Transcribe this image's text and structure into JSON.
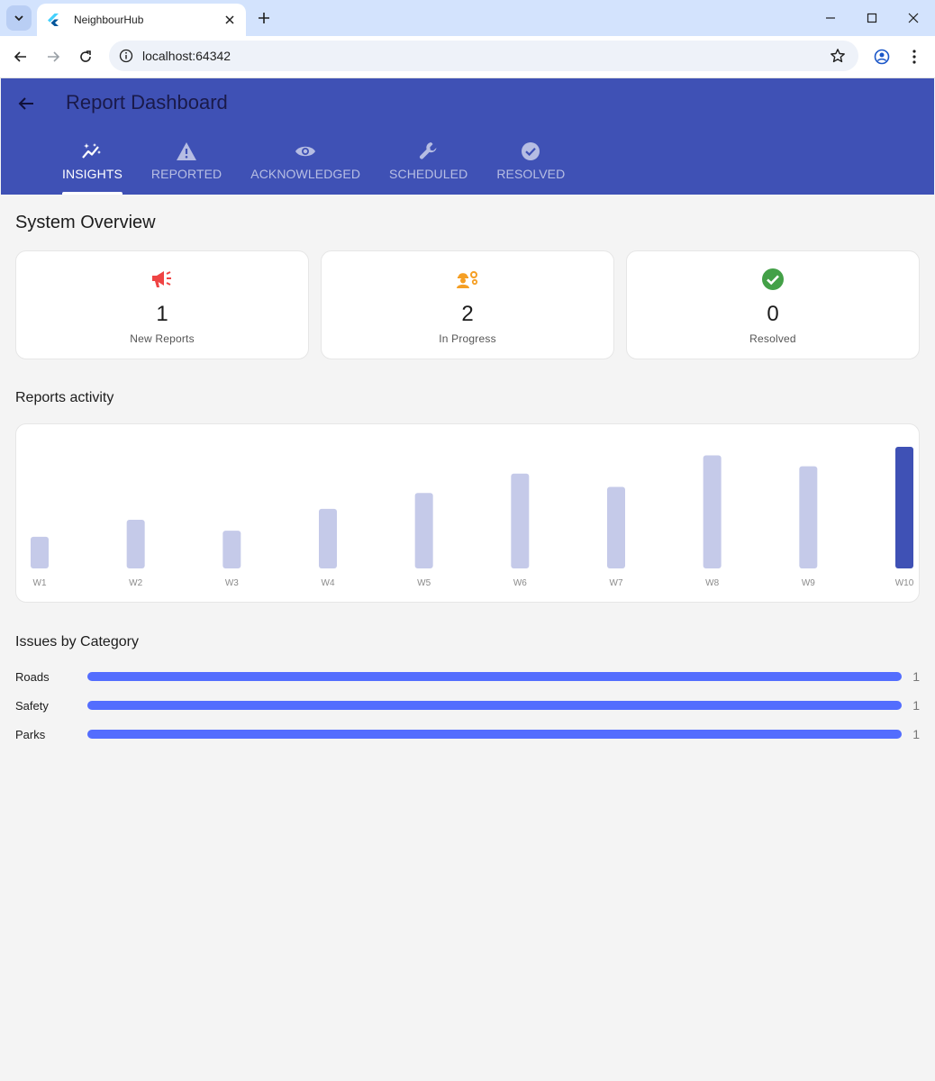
{
  "browser": {
    "tab_title": "NeighbourHub",
    "url": "localhost:64342"
  },
  "app": {
    "title": "Report Dashboard",
    "tabs": [
      {
        "label": "INSIGHTS",
        "icon": "insights-icon",
        "active": true
      },
      {
        "label": "REPORTED",
        "icon": "warning-icon",
        "active": false
      },
      {
        "label": "ACKNOWLEDGED",
        "icon": "eye-icon",
        "active": false
      },
      {
        "label": "SCHEDULED",
        "icon": "wrench-icon",
        "active": false
      },
      {
        "label": "RESOLVED",
        "icon": "check-circle-icon",
        "active": false
      }
    ],
    "colors": {
      "primary": "#3f51b5",
      "accent": "#536dfe",
      "new": "#ef4444",
      "progress": "#f59f24",
      "resolved": "#43a047"
    }
  },
  "overview": {
    "heading": "System Overview",
    "stats": [
      {
        "value": "1",
        "label": "New Reports",
        "icon": "megaphone-icon"
      },
      {
        "value": "2",
        "label": "In Progress",
        "icon": "worker-icon"
      },
      {
        "value": "0",
        "label": "Resolved",
        "icon": "check-circle-icon"
      }
    ]
  },
  "activity": {
    "heading": "Reports activity"
  },
  "chart_data": {
    "type": "bar",
    "categories": [
      "W1",
      "W2",
      "W3",
      "W4",
      "W5",
      "W6",
      "W7",
      "W8",
      "W9",
      "W10"
    ],
    "values": [
      0.26,
      0.4,
      0.31,
      0.49,
      0.62,
      0.78,
      0.67,
      0.93,
      0.84,
      1.0
    ],
    "highlight_index": 9,
    "ylim": [
      0,
      1
    ],
    "grid": false
  },
  "categories": {
    "heading": "Issues by Category",
    "items": [
      {
        "name": "Roads",
        "count": "1",
        "fraction": 1.0
      },
      {
        "name": "Safety",
        "count": "1",
        "fraction": 1.0
      },
      {
        "name": "Parks",
        "count": "1",
        "fraction": 1.0
      }
    ]
  }
}
